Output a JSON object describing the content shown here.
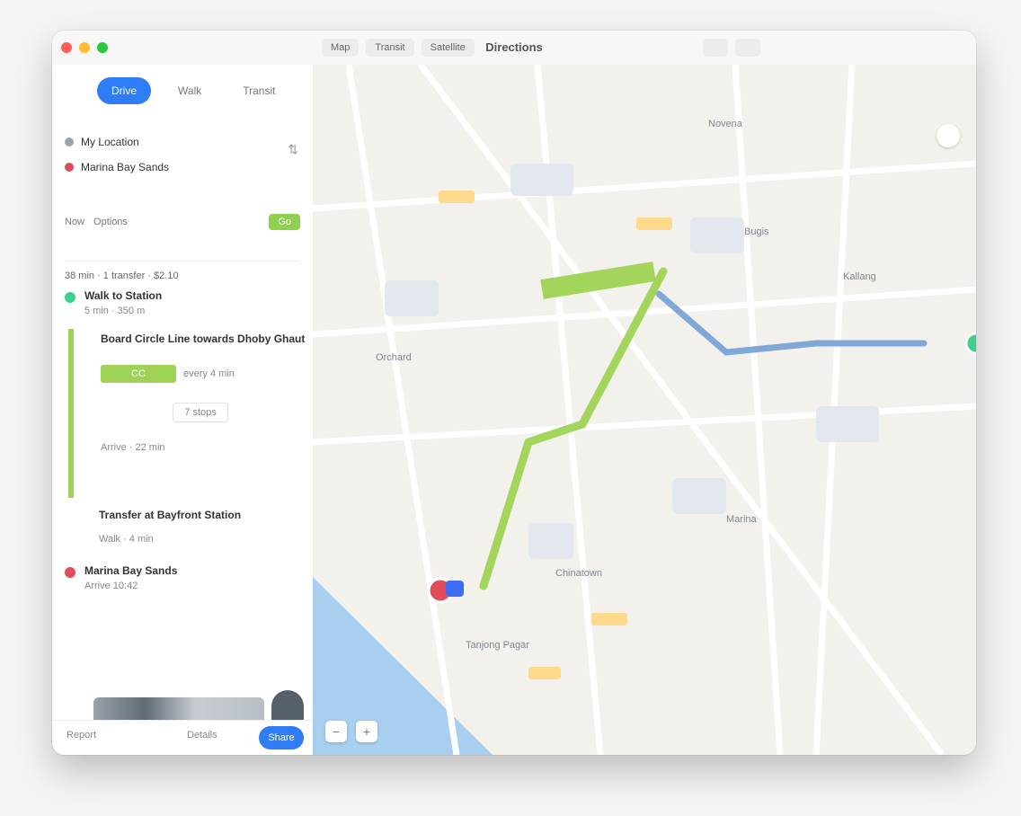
{
  "window": {
    "title": "Directions"
  },
  "toolbar": {
    "buttons": [
      "Map",
      "Transit",
      "Satellite"
    ]
  },
  "sidebar": {
    "modes": [
      "Drive",
      "Walk",
      "Transit"
    ],
    "from": "My Location",
    "to": "Marina Bay Sands",
    "options_label": "Now",
    "options_prefs": "Options",
    "go_label": "Go",
    "summary": "38 min  ·  1 transfer  ·  $2.10",
    "start_title": "Walk to Station",
    "start_sub": "5 min  ·  350 m",
    "leg_title": "Board Circle Line towards Dhoby Ghaut",
    "line_label": "CC",
    "line_dir": "every 4 min",
    "stops_label": "7 stops",
    "leg_arrive": "Arrive  ·  22 min",
    "transfer_title": "Transfer at Bayfront Station",
    "transfer_sub": "Walk  ·  4 min",
    "dest_title": "Marina Bay Sands",
    "dest_sub": "Arrive 10:42",
    "bottom_left": "Report",
    "bottom_mid": "Details",
    "share_label": "Share"
  },
  "map": {
    "labels": [
      "Orchard",
      "Novena",
      "Bugis",
      "Kallang",
      "Tanjong Pagar",
      "Chinatown",
      "Marina"
    ],
    "colors": {
      "route": "#a3d45b",
      "walk": "#7fa8d9",
      "start": "#3ccf8e",
      "end": "#e24b5b",
      "water": "#a9cfee"
    }
  }
}
